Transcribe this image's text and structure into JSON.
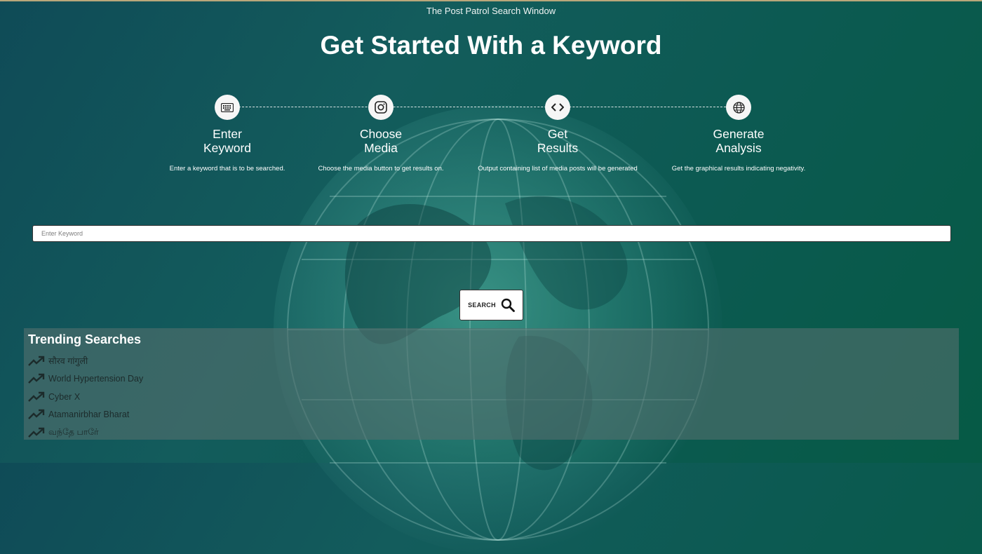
{
  "window_title": "The Post Patrol Search Window",
  "hero_title": "Get Started With a Keyword",
  "steps": [
    {
      "title": "Enter\nKeyword",
      "description": "Enter a keyword that is to be searched.",
      "icon": "keyboard-icon"
    },
    {
      "title": "Choose\nMedia",
      "description": "Choose the media button to get results on.",
      "icon": "instagram-icon"
    },
    {
      "title": "Get\nResults",
      "description": "Output containing list of media posts will be generated",
      "icon": "code-icon"
    },
    {
      "title": "Generate\nAnalysis",
      "description": "Get the graphical results indicating negativity.",
      "icon": "globe-icon"
    }
  ],
  "search": {
    "placeholder": "Enter Keyword",
    "button_label": "SEARCH",
    "button_icon": "magnifier-icon"
  },
  "trending": {
    "heading": "Trending Searches",
    "items": [
      "सौरव गांगुली",
      "World Hypertension Day",
      "Cyber X",
      "Atamanirbhar Bharat",
      "வந்தே பாரே்"
    ]
  }
}
